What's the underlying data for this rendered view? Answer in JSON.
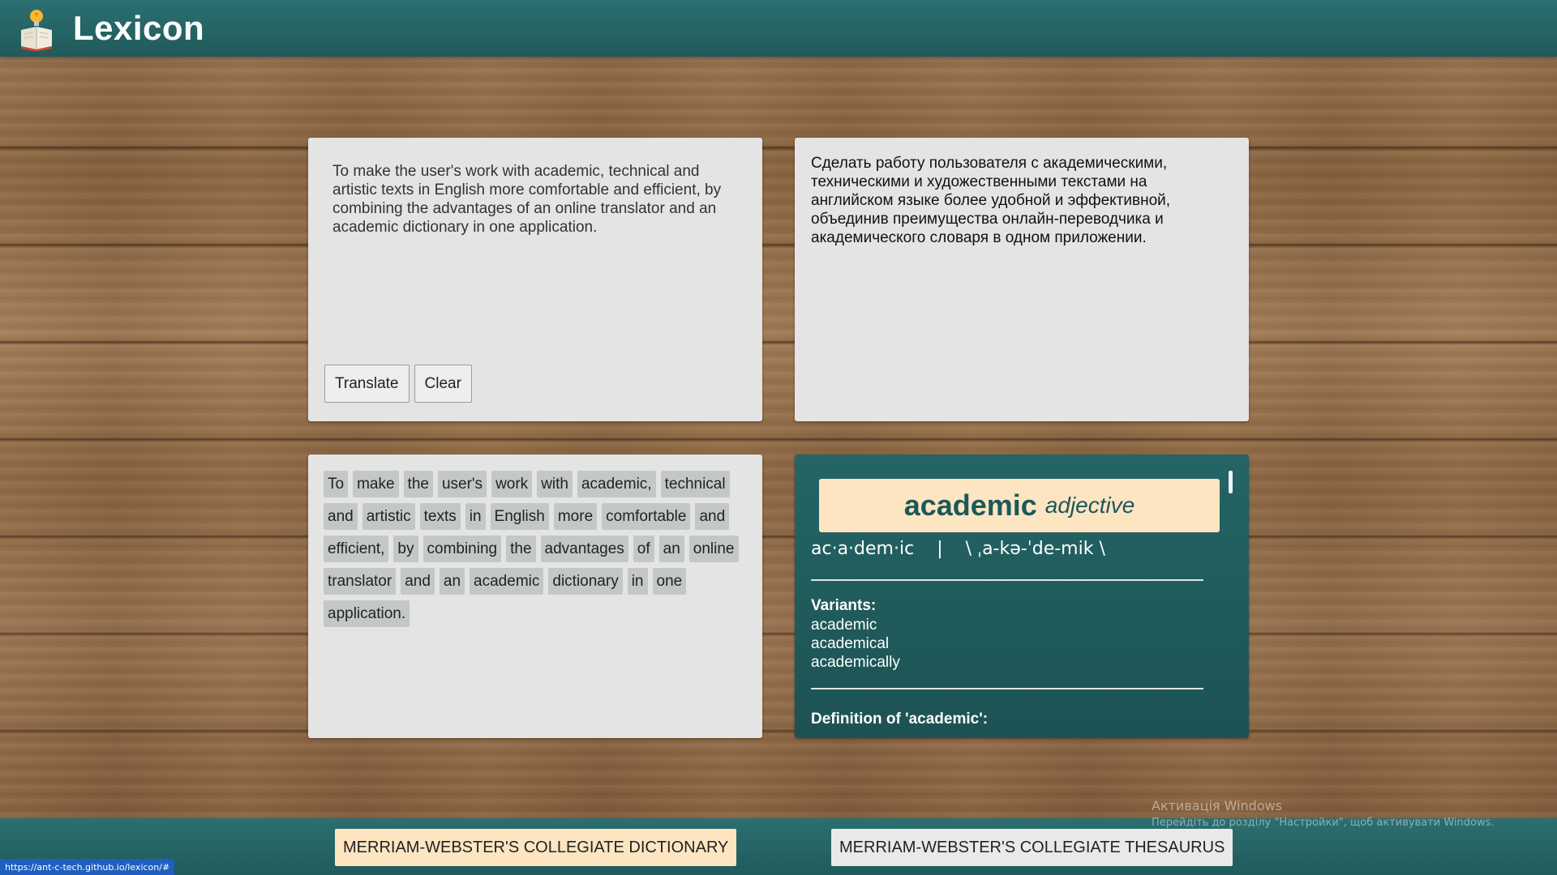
{
  "header": {
    "title": "Lexicon"
  },
  "input": {
    "text": "To make the user's work with academic, technical and artistic texts in English more comfortable and efficient, by combining the advantages of an online translator and an academic dictionary in one application.",
    "translate_label": "Translate",
    "clear_label": "Clear"
  },
  "output": {
    "text": "Сделать работу пользователя с академическими, техническими и художественными текстами на английском языке более удобной и эффективной, объединив преимущества онлайн-переводчика и академического словаря в одном приложении."
  },
  "words": [
    "To",
    "make",
    "the",
    "user's",
    "work",
    "with",
    "academic,",
    "technical",
    "and",
    "artistic",
    "texts",
    "in",
    "English",
    "more",
    "comfortable",
    "and",
    "efficient,",
    "by",
    "combining",
    "the",
    "advantages",
    "of",
    "an",
    "online",
    "translator",
    "and",
    "an",
    "academic",
    "dictionary",
    "in",
    "one",
    "application."
  ],
  "dictionary": {
    "headword": "academic",
    "part_of_speech": "adjective",
    "syllables": "ac·a·dem·ic",
    "separator": "|",
    "pronunciation": "\\ ˌa-kə-ˈde-mik \\",
    "variants_label": "Variants:",
    "variants": [
      "academic",
      "academical",
      "academically"
    ],
    "definition_label": "Definition of 'academic':"
  },
  "footer": {
    "dictionary_label": "MERRIAM-WEBSTER'S COLLEGIATE DICTIONARY",
    "thesaurus_label": "MERRIAM-WEBSTER'S COLLEGIATE THESAURUS"
  },
  "system": {
    "activation_title": "Активація Windows",
    "activation_text": "Перейдіть до розділу \"Настройки\", щоб активувати Windows.",
    "status_url": "https://ant-c-tech.github.io/lexicon/#"
  },
  "colors": {
    "header": "#246566",
    "panel": "#e4e4e4",
    "chip": "#c3c8c6",
    "accent_card": "#fde5c2"
  }
}
